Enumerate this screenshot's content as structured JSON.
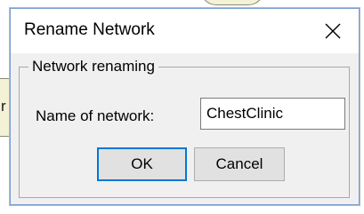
{
  "dialog": {
    "title": "Rename Network",
    "close_icon": "close-icon"
  },
  "group": {
    "legend": "Network renaming",
    "field_label": "Name of network:",
    "field_value": "ChestClinic"
  },
  "buttons": {
    "ok_label": "OK",
    "cancel_label": "Cancel"
  },
  "background": {
    "partial_text": "r"
  },
  "colors": {
    "dialog_bg": "#f0f0f0",
    "titlebar_bg": "#ffffff",
    "default_button_border": "#0078d7",
    "node_fill": "#f3f1d6"
  }
}
